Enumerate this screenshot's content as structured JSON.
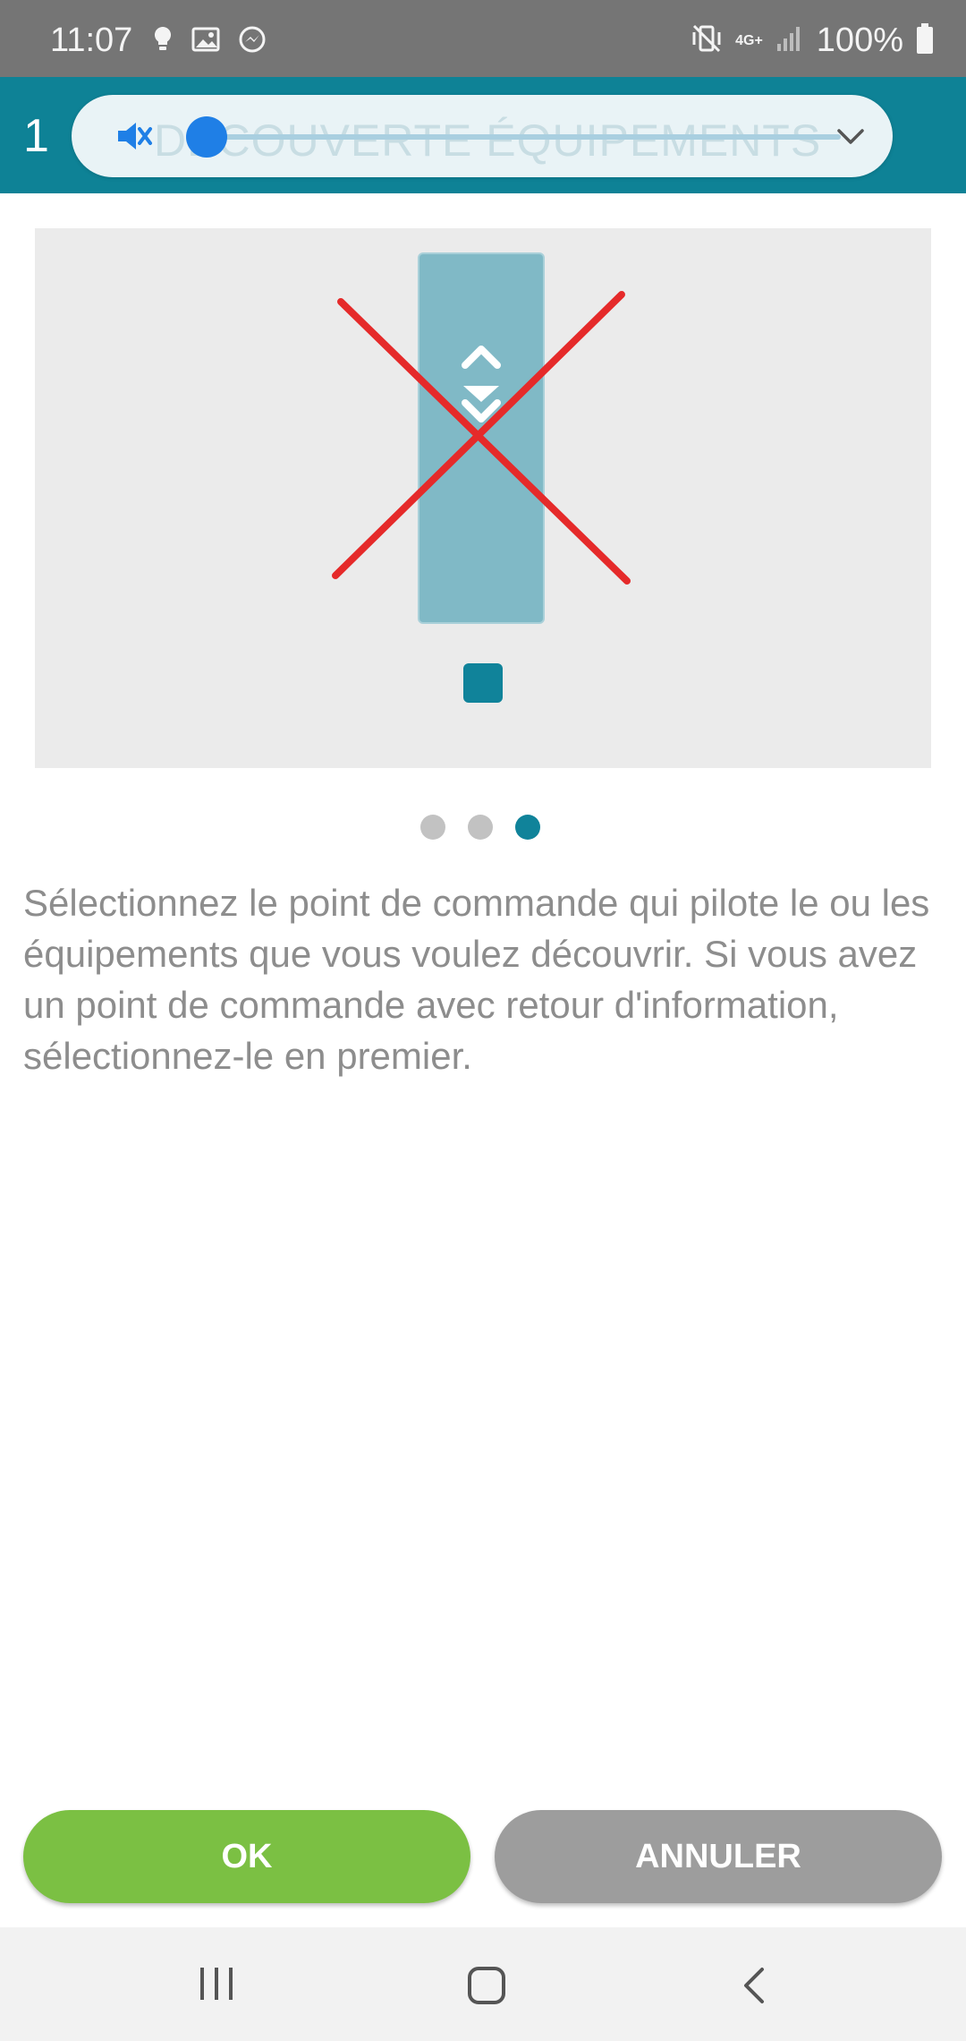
{
  "status_bar": {
    "time": "11:07",
    "battery": "100%",
    "network": "4G+",
    "icons": [
      "bulb-icon",
      "image-icon",
      "messenger-icon",
      "vibrate-icon",
      "signal-icon",
      "battery-icon"
    ]
  },
  "toolbar": {
    "step_number": "1",
    "title": "DÉCOUVERTE ÉQUIPEMENTS",
    "accent_color": "#0e8296"
  },
  "carousel": {
    "page_count": 3,
    "active_index": 2
  },
  "description": "Sélectionnez le point de commande qui pilote le ou les équipements que vous voulez découvrir. Si vous avez un point de commande avec retour d'information, sélectionnez-le en premier.",
  "actions": {
    "ok_label": "OK",
    "cancel_label": "ANNULER",
    "ok_color": "#7bc043",
    "cancel_color": "#9d9d9d"
  }
}
